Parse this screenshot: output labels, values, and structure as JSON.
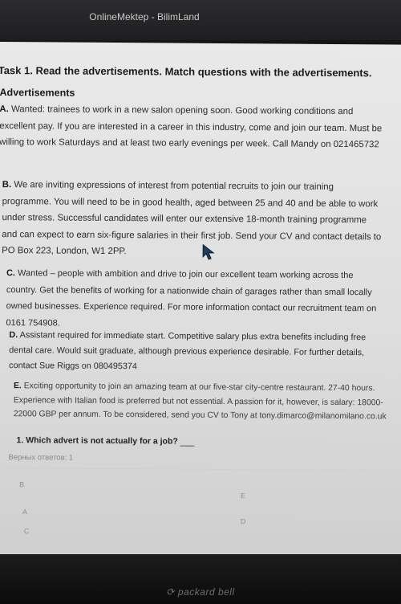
{
  "window": {
    "title": "OnlineMektep - BilimLand"
  },
  "task": {
    "title": "Task 1. Read the advertisements. Match questions with the advertisements.",
    "heading": "Advertisements"
  },
  "ads": {
    "a": {
      "label": "A.",
      "text": "Wanted: trainees to work in a new salon opening soon. Good working conditions and excellent pay. If you are interested in a career in this industry, come and join our team. Must be willing to work Saturdays and at least two early evenings per week. Call Mandy on 021465732"
    },
    "b": {
      "label": "B.",
      "text": "We are inviting expressions of interest from potential recruits to join our training programme. You will need to be in good health, aged between 25 and 40 and be able to work under stress. Successful candidates will enter our extensive 18-month training programme and can expect to earn six-figure salaries in their first job. Send your CV and contact details to PO Box 223, London, W1 2PP."
    },
    "c": {
      "label": "C.",
      "text": "Wanted – people with ambition and drive to join our excellent team working across the country. Get the benefits of working for a nationwide chain of garages rather than small locally owned businesses. Experience required. For more information contact our recruitment team on 0161 754908."
    },
    "d": {
      "label": "D.",
      "text": "Assistant required for immediate start. Competitive salary plus extra benefits including free dental care. Would suit graduate, although previous experience desirable. For further details, contact Sue Riggs on 080495374"
    },
    "e": {
      "label": "E.",
      "text": "Exciting opportunity to join an amazing team at our five-star city-centre restaurant. 27-40 hours. Experience with Italian food is preferred but not essential. A passion for it, however, is salary: 18000-22000 GBP per annum. To be considered, send you CV to Tony at tony.dimarco@milanomilano.co.uk"
    }
  },
  "question": {
    "text": "1. Which advert is not actually for a job?"
  },
  "answers": {
    "correct_label": "Верных ответов: 1",
    "options": [
      "B",
      "E",
      "A",
      "D",
      "C"
    ]
  },
  "device": {
    "brand": "packard bell"
  }
}
